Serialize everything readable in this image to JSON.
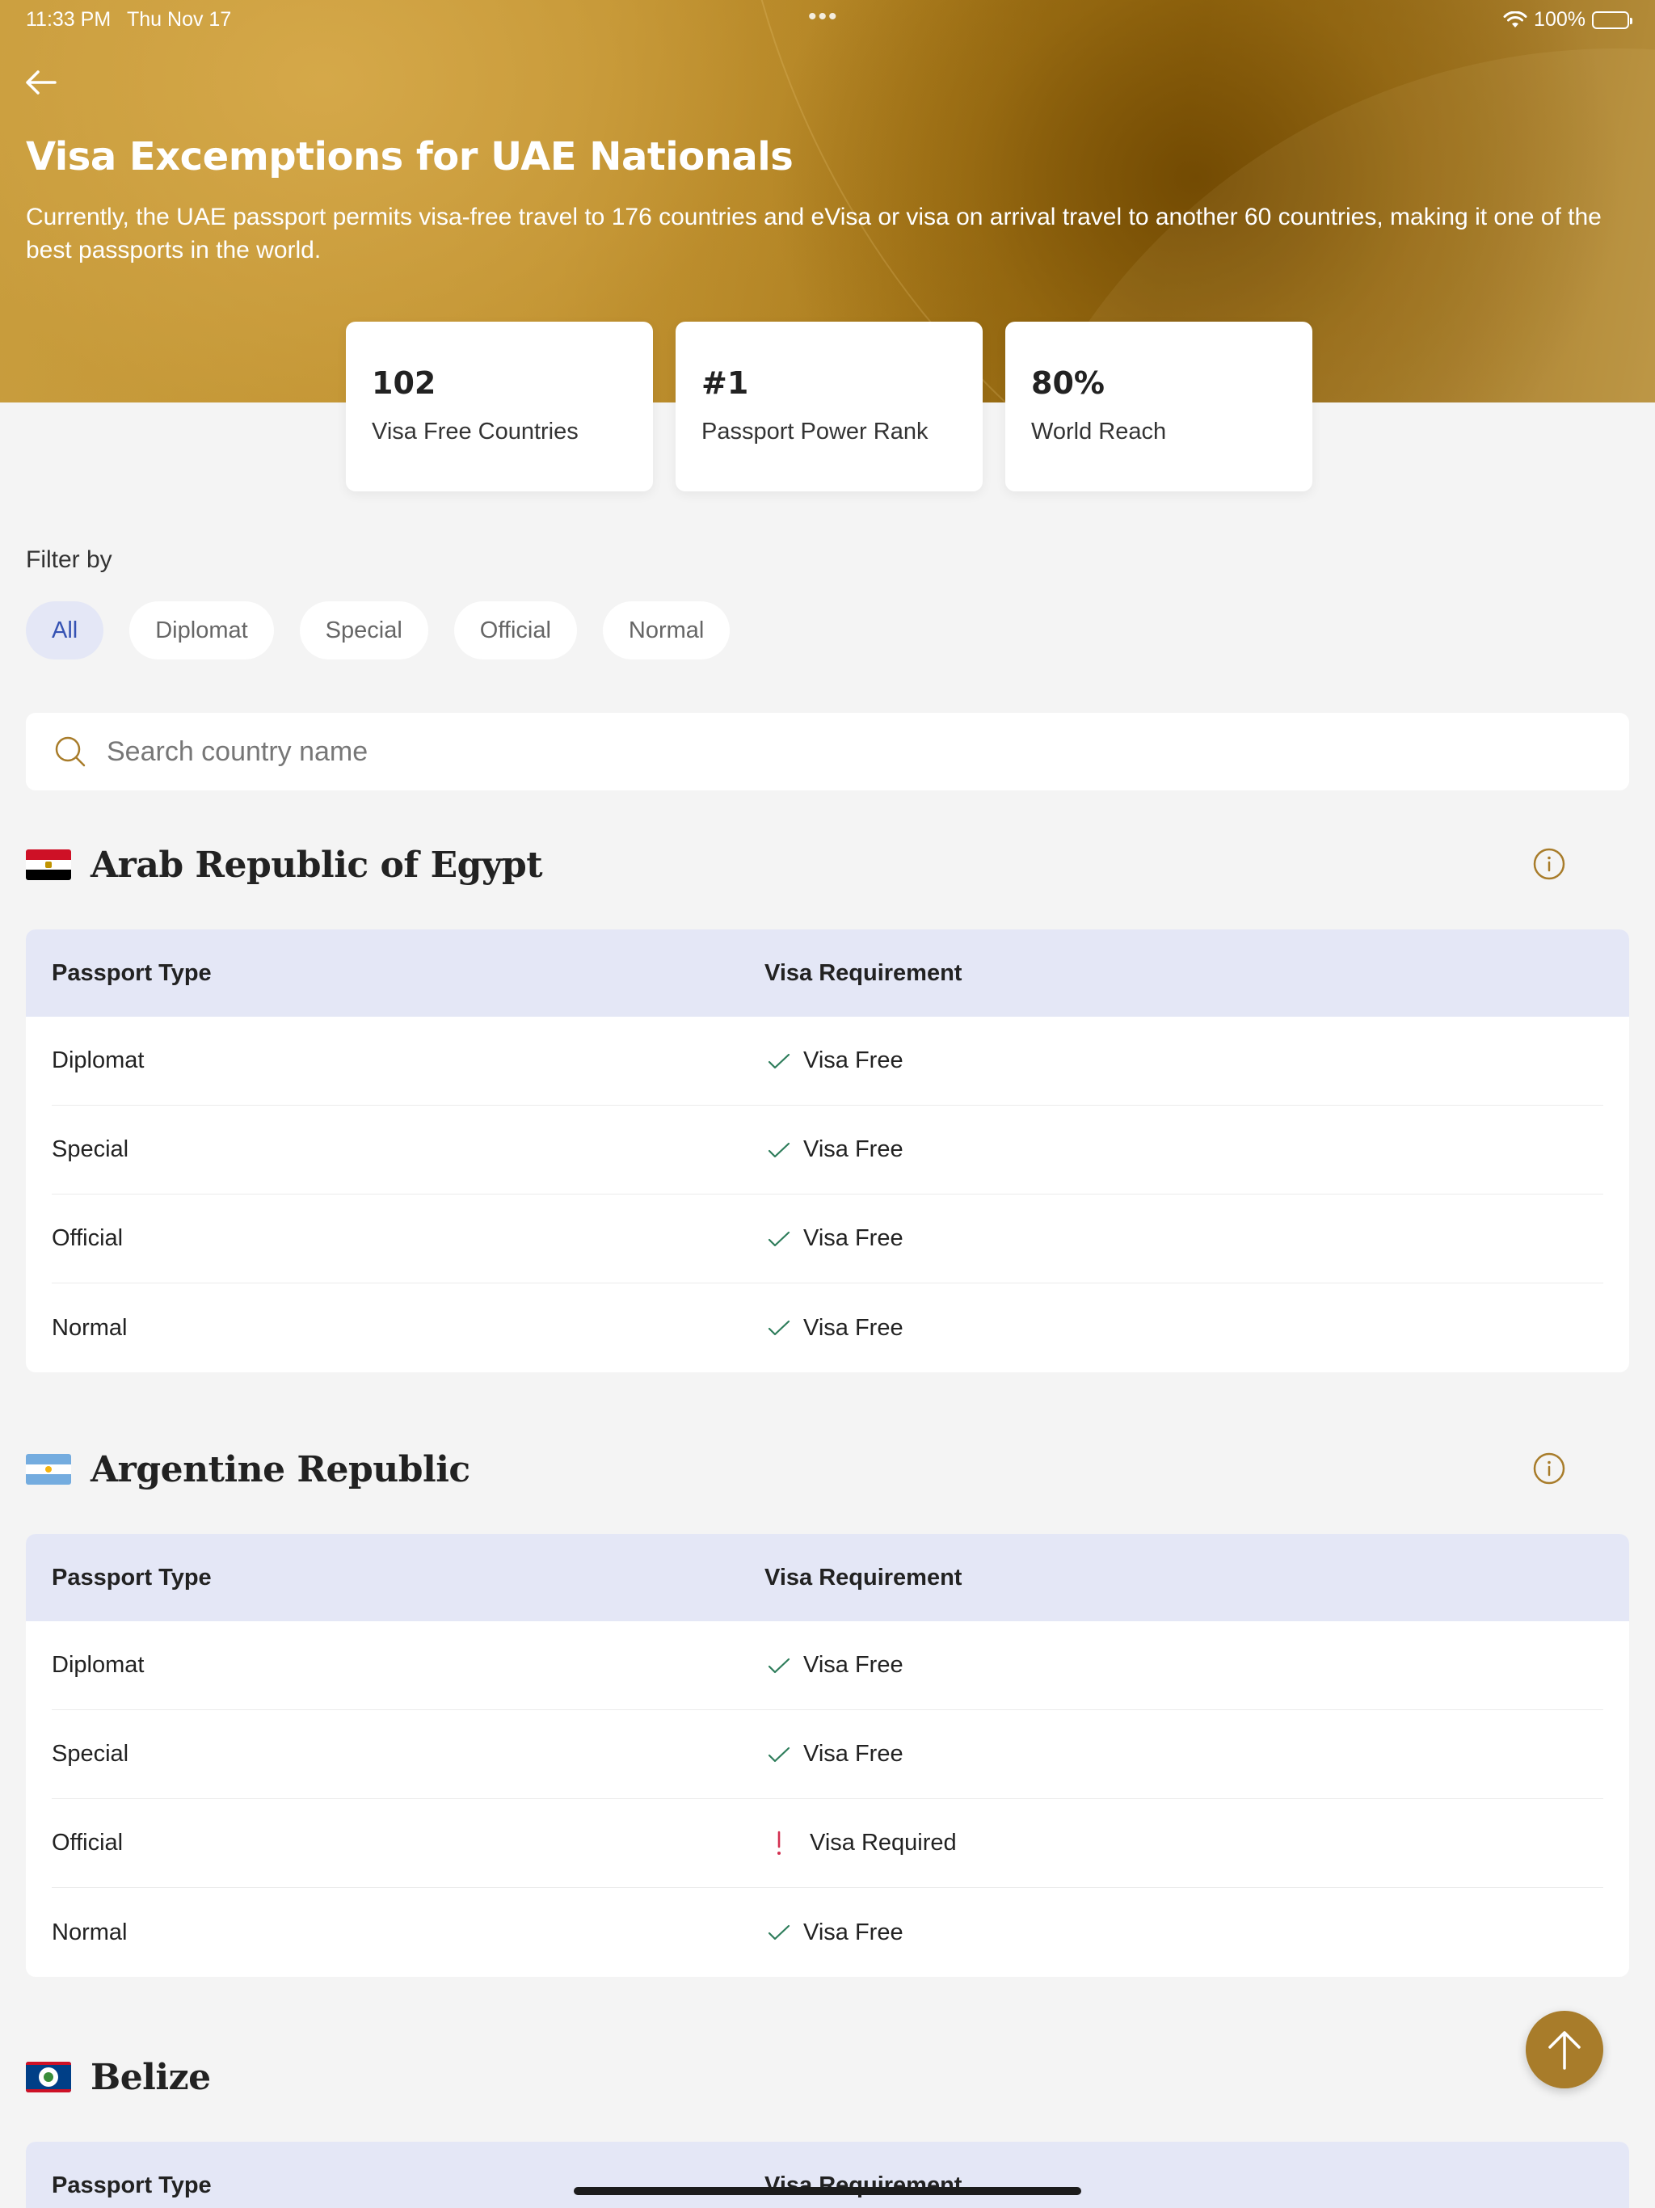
{
  "status_bar": {
    "time": "11:33 PM",
    "date": "Thu Nov 17",
    "battery": "100%"
  },
  "header": {
    "title": "Visa Excemptions for UAE Nationals",
    "description": "Currently, the UAE passport permits visa-free travel to 176 countries and eVisa or visa on arrival travel to another 60 countries, making it one of the best passports in the world."
  },
  "stats": [
    {
      "value": "102",
      "label": "Visa Free Countries"
    },
    {
      "value": "#1",
      "label": "Passport Power Rank"
    },
    {
      "value": "80%",
      "label": "World Reach"
    }
  ],
  "filter": {
    "label": "Filter by",
    "options": [
      "All",
      "Diplomat",
      "Special",
      "Official",
      "Normal"
    ],
    "selected": "All"
  },
  "search": {
    "placeholder": "Search country name"
  },
  "table_headers": {
    "passport_type": "Passport Type",
    "visa_requirement": "Visa Requirement"
  },
  "countries": [
    {
      "name": "Arab Republic of Egypt",
      "flag": "egypt-flag",
      "rows": [
        {
          "type": "Diplomat",
          "requirement": "Visa Free",
          "status": "free"
        },
        {
          "type": "Special",
          "requirement": "Visa Free",
          "status": "free"
        },
        {
          "type": "Official",
          "requirement": "Visa Free",
          "status": "free"
        },
        {
          "type": "Normal",
          "requirement": "Visa Free",
          "status": "free"
        }
      ]
    },
    {
      "name": "Argentine Republic",
      "flag": "argentina-flag",
      "rows": [
        {
          "type": "Diplomat",
          "requirement": "Visa Free",
          "status": "free"
        },
        {
          "type": "Special",
          "requirement": "Visa Free",
          "status": "free"
        },
        {
          "type": "Official",
          "requirement": "Visa Required",
          "status": "required"
        },
        {
          "type": "Normal",
          "requirement": "Visa Free",
          "status": "free"
        }
      ]
    },
    {
      "name": "Belize",
      "flag": "belize-flag",
      "rows": []
    }
  ],
  "colors": {
    "accent_gold": "#a87c2a",
    "chip_active_bg": "#e4e7f6",
    "chip_active_text": "#3552b3",
    "visa_free_check": "#2e7d5b",
    "visa_required_mark": "#d32f4f"
  }
}
